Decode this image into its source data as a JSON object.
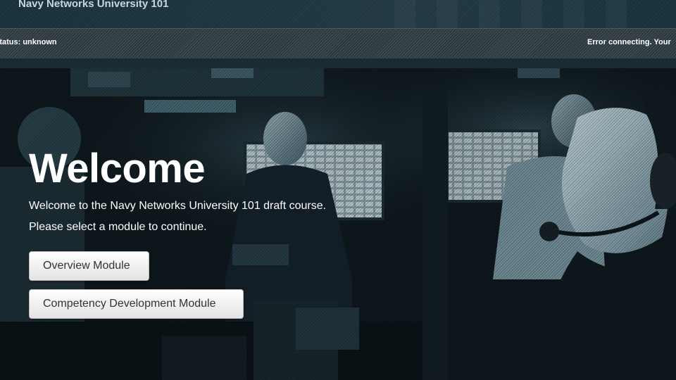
{
  "header": {
    "app_title": "Navy Networks University 101"
  },
  "status_bar": {
    "left_status": "Status: unknown",
    "right_status": "Error connecting. Your"
  },
  "hero": {
    "heading": "Welcome",
    "intro_line": "Welcome to the Navy Networks University 101 draft course.",
    "instruction_line": "Please select a module to continue.",
    "modules": [
      {
        "label": "Overview Module"
      },
      {
        "label": "Competency Development Module"
      }
    ],
    "background_image": "navy-control-room-photo"
  },
  "colors": {
    "accent_teal": "#1b323d",
    "status_bar_bg": "#333f44",
    "text_primary": "#ffffff",
    "button_bg": "#f2f2f2",
    "button_text": "#333333"
  }
}
